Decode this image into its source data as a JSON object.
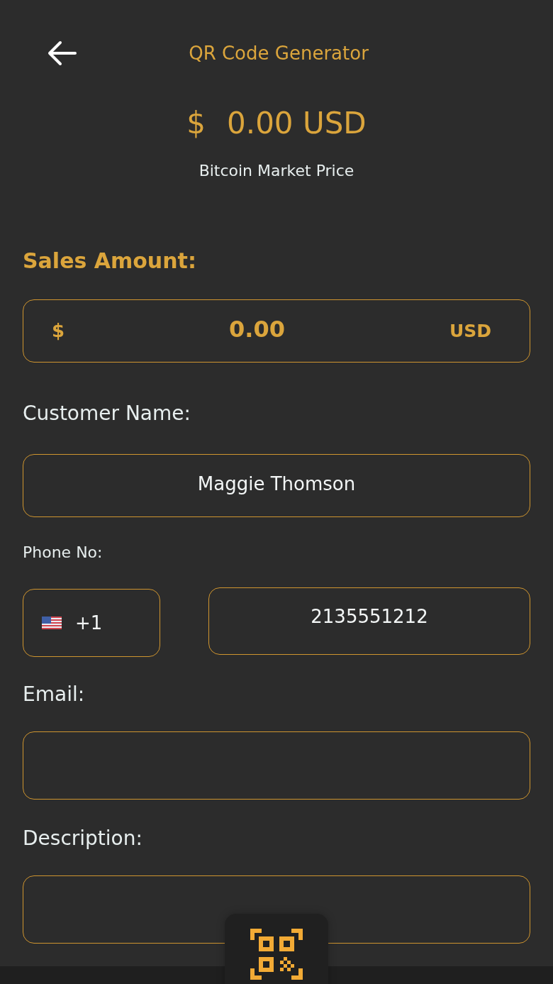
{
  "header": {
    "title": "QR Code Generator"
  },
  "price": {
    "currency_symbol": "$",
    "amount": "0.00 USD",
    "caption": "Bitcoin Market Price"
  },
  "sales_amount": {
    "label": "Sales Amount:",
    "currency_symbol": "$",
    "value": "0.00",
    "currency": "USD"
  },
  "customer_name": {
    "label": "Customer Name:",
    "value": "Maggie Thomson"
  },
  "phone": {
    "label": "Phone No:",
    "country_code": "+1",
    "number": "2135551212"
  },
  "email": {
    "label": "Email:"
  },
  "description": {
    "label": "Description:"
  }
}
